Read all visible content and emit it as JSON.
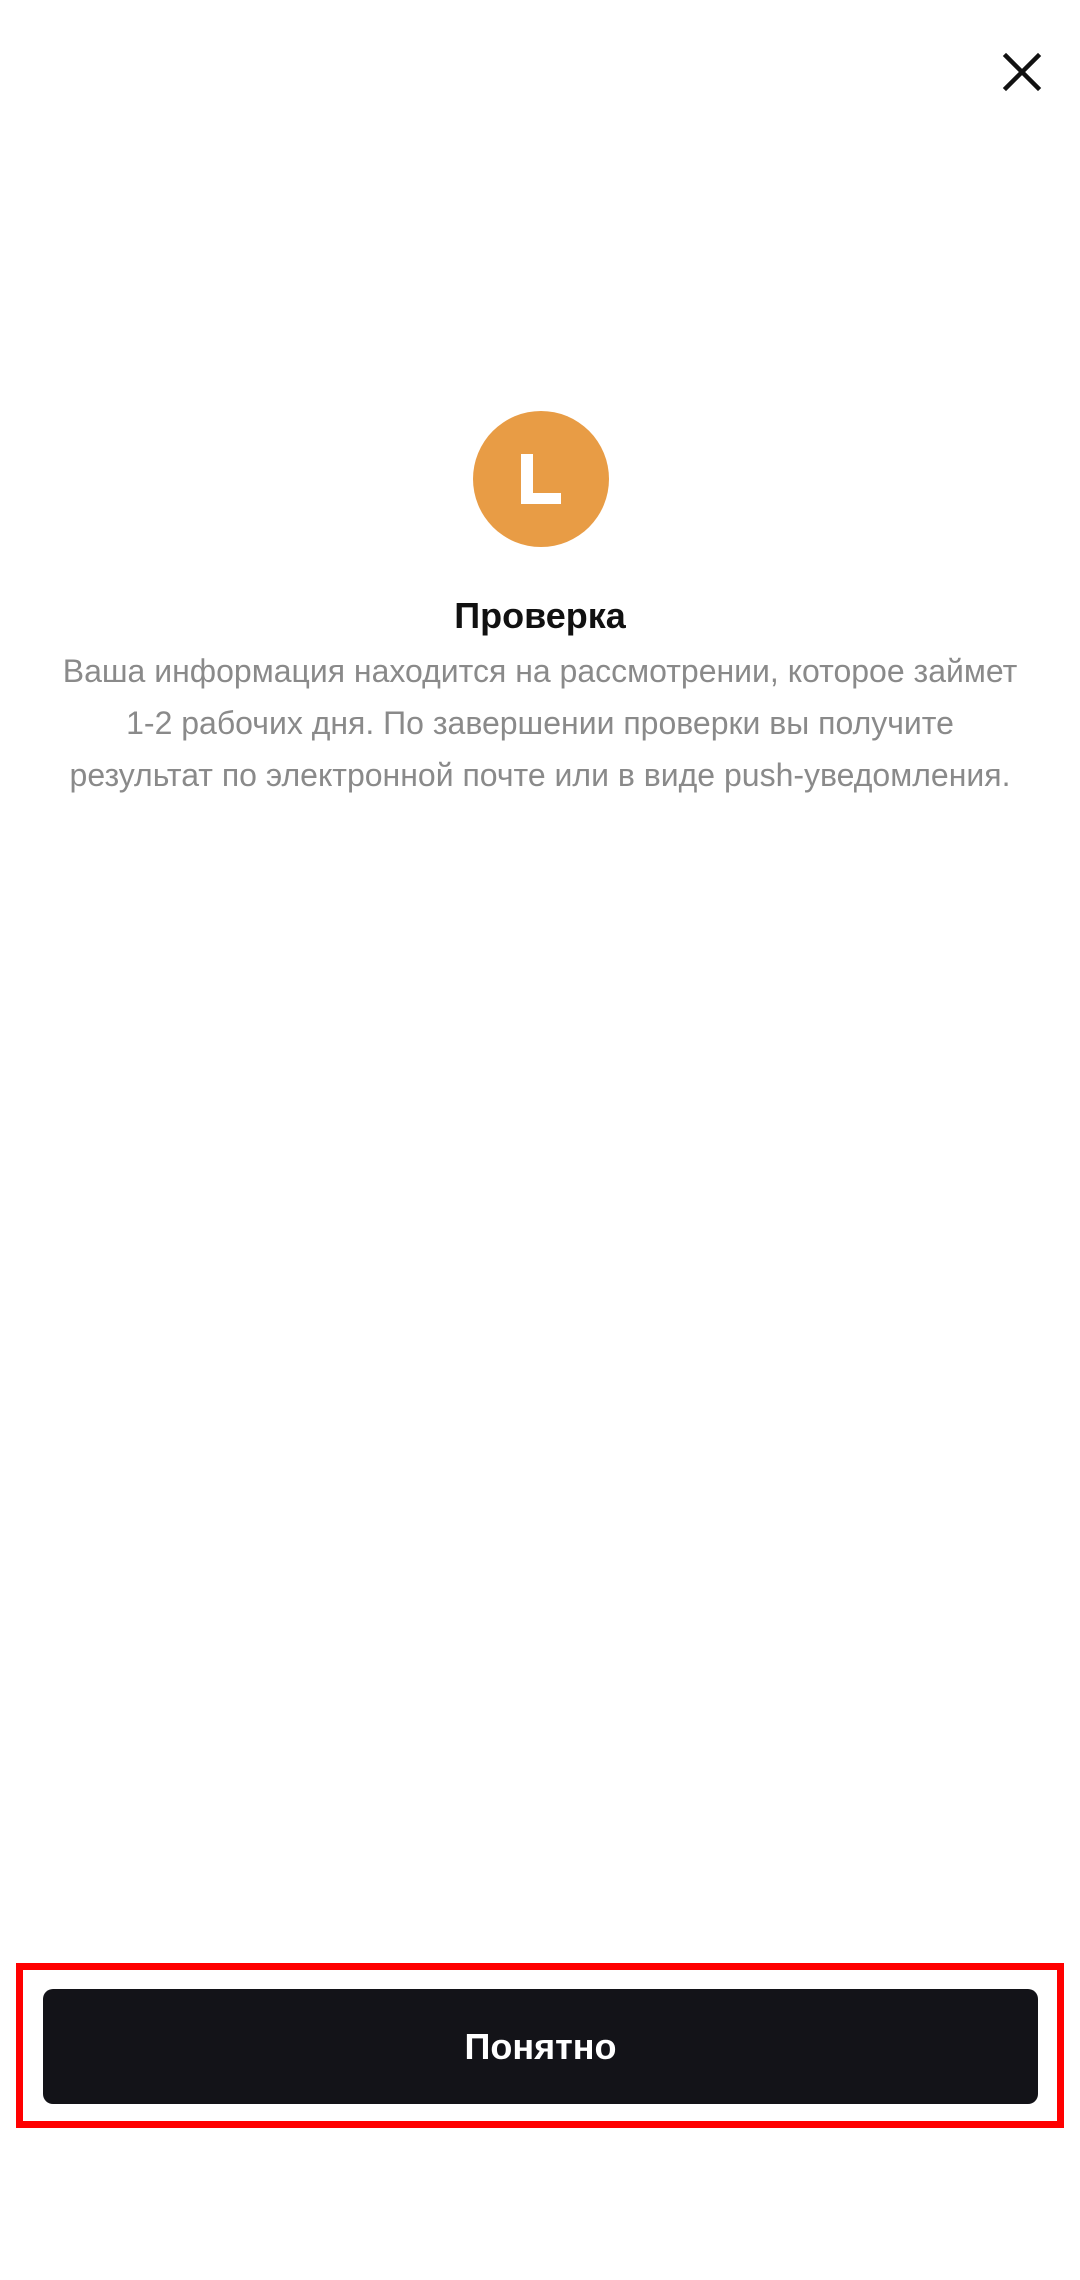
{
  "colors": {
    "accent": "#E89C45",
    "button_bg": "#131318",
    "button_text": "#FFFFFF",
    "title": "#111111",
    "description": "#8A8A8A",
    "highlight": "#FF0000"
  },
  "icons": {
    "close": "close-icon",
    "status": "verification-pending-icon"
  },
  "content": {
    "title": "Проверка",
    "description": "Ваша информация находится на рассмотрении, которое займет 1-2 рабочих дня. По завершении проверки вы получите результат по электронной почте или в виде push-уведомления."
  },
  "actions": {
    "confirm_label": "Понятно"
  }
}
